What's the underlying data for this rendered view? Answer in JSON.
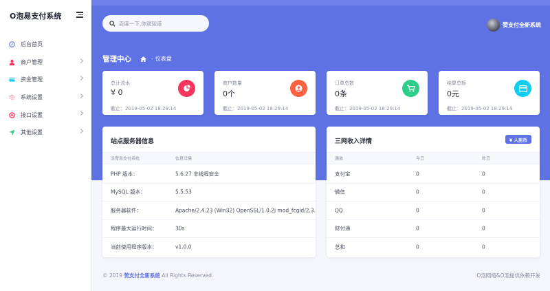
{
  "app": {
    "title": "O泡易支付系统"
  },
  "colors": {
    "accent": "#5e72e4",
    "red": "#f5365c",
    "orange": "#fb6340",
    "green": "#2dce89",
    "blue": "#11cdef"
  },
  "sidebar": {
    "items": [
      {
        "label": "后台首页",
        "icon": "compass-icon",
        "color": "#5e72e4",
        "has_chevron": false
      },
      {
        "label": "商户管理",
        "icon": "user-icon",
        "color": "#f5365c",
        "has_chevron": true
      },
      {
        "label": "资金管理",
        "icon": "card-icon",
        "color": "#11cdef",
        "has_chevron": true
      },
      {
        "label": "系统设置",
        "icon": "gear-icon",
        "color": "#f3a4b5",
        "has_chevron": true
      },
      {
        "label": "接口设置",
        "icon": "plug-icon",
        "color": "#f5365c",
        "has_chevron": true
      },
      {
        "label": "其他设置",
        "icon": "send-icon",
        "color": "#2dce89",
        "has_chevron": true
      }
    ]
  },
  "header": {
    "search_placeholder": "百度一下,你就知道",
    "user_name": "赞支付全新系统",
    "page_title": "管理中心",
    "breadcrumb": {
      "sep": "-",
      "current": "仪表盘"
    }
  },
  "stats": [
    {
      "label": "总计流水",
      "value": "¥ 0",
      "time": "截止：2019-05-02 18:29:14",
      "icon": "pie-chart-icon"
    },
    {
      "label": "商户数量",
      "value": "0个",
      "time": "截止：2019-05-02 18:29:14",
      "icon": "user-circle-icon"
    },
    {
      "label": "订单总数",
      "value": "0条",
      "time": "截止：2019-05-02 18:29:14",
      "icon": "cart-icon"
    },
    {
      "label": "结算总额",
      "value": "0元",
      "time": "截止：2019-05-02 18:29:14",
      "icon": "wallet-icon"
    }
  ],
  "server": {
    "title": "站点服务器信息",
    "headers": [
      "泳雪易支付系统",
      "信息详情"
    ],
    "rows": [
      {
        "key": "PHP 版本：",
        "value": "5.6.27 非线程安全"
      },
      {
        "key": "MySQL 版本：",
        "value": "5.5.53"
      },
      {
        "key": "服务器软件：",
        "value": "Apache/2.4.23 (Win32) OpenSSL/1.0.2j mod_fcgid/2.3.9"
      },
      {
        "key": "程序最大运行时间：",
        "value": "30s"
      },
      {
        "key": "当前使用程序版本：",
        "value": "v1.0.0"
      }
    ]
  },
  "income": {
    "title": "三网收入详情",
    "button": "¥ 人民币",
    "headers": [
      "通道",
      "今日",
      "昨日"
    ],
    "rows": [
      {
        "channel": "支付宝",
        "today": "0",
        "yesterday": "0"
      },
      {
        "channel": "微信",
        "today": "0",
        "yesterday": "0"
      },
      {
        "channel": "QQ",
        "today": "0",
        "yesterday": "0"
      },
      {
        "channel": "财付通",
        "today": "0",
        "yesterday": "0"
      },
      {
        "channel": "总和",
        "today": "0",
        "yesterday": "0"
      }
    ]
  },
  "footer": {
    "copyright_prefix": "© 2019",
    "link": "赞支付全新系统",
    "copyright_suffix": "All Rights Reserved.",
    "right": "O泡网络&O泡提供依赖开发"
  }
}
